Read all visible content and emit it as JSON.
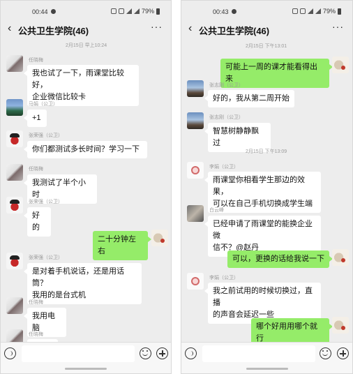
{
  "left": {
    "status_time": "00:44",
    "battery": "79%",
    "title": "公共卫生学院(46)",
    "time_label": "2月15日 早上10:24",
    "messages": [
      {
        "sender": "任晓梅",
        "text": "我也试了一下，雨课堂比较好，\n企业微信比较卡"
      },
      {
        "sender": "马娟（公卫）",
        "text": "+1"
      },
      {
        "sender": "张荣强（公卫）",
        "text": "你们都测试多长时间？学习一下"
      },
      {
        "sender": "任晓梅",
        "text": "我测试了半个小时"
      },
      {
        "sender": "张荣强（公卫）",
        "text": "好的"
      },
      {
        "sender": "",
        "text": "二十分钟左右"
      },
      {
        "sender": "张荣强（公卫）",
        "text": "是对着手机说话，还是用话筒？\n我用的是台式机"
      },
      {
        "sender": "任晓梅",
        "text": "我用电脑"
      },
      {
        "sender": "任晓梅",
        "text": ""
      }
    ]
  },
  "right": {
    "status_time": "00:43",
    "battery": "79%",
    "title": "公共卫生学院(46)",
    "time_labels": [
      "2月15日 下午13:01",
      "2月15日 下午13:09"
    ],
    "messages": [
      {
        "sender": "",
        "text": "可能上一周的课才能看得出来"
      },
      {
        "sender": "张志刚（公卫）",
        "text": "好的，我从第二周开始"
      },
      {
        "sender": "张志刚（公卫）",
        "text": "智慧树静静飘过"
      },
      {
        "sender": "李娟（公卫）",
        "text": "雨课堂你相看学生那边的效果，\n可以在自己手机切换成学生端"
      },
      {
        "sender": "白云峰",
        "text": "已经申请了雨课堂的能换企业微\n信不？@赵丹"
      },
      {
        "sender": "",
        "text": "可以，更换的话给我说一下"
      },
      {
        "sender": "李娟（公卫）",
        "text": "我之前试用的时候切换过，直播\n的声音会延迟一些"
      },
      {
        "sender": "",
        "text": "哪个好用用哪个就行"
      }
    ]
  },
  "icons": {
    "back": "back-arrow-icon",
    "more": "more-dots-icon",
    "voice": "voice-icon",
    "emoji": "emoji-icon",
    "plus": "plus-icon"
  },
  "colors": {
    "own_bubble": "#95ec69",
    "other_bubble": "#ffffff",
    "chat_background": "#ededed"
  }
}
